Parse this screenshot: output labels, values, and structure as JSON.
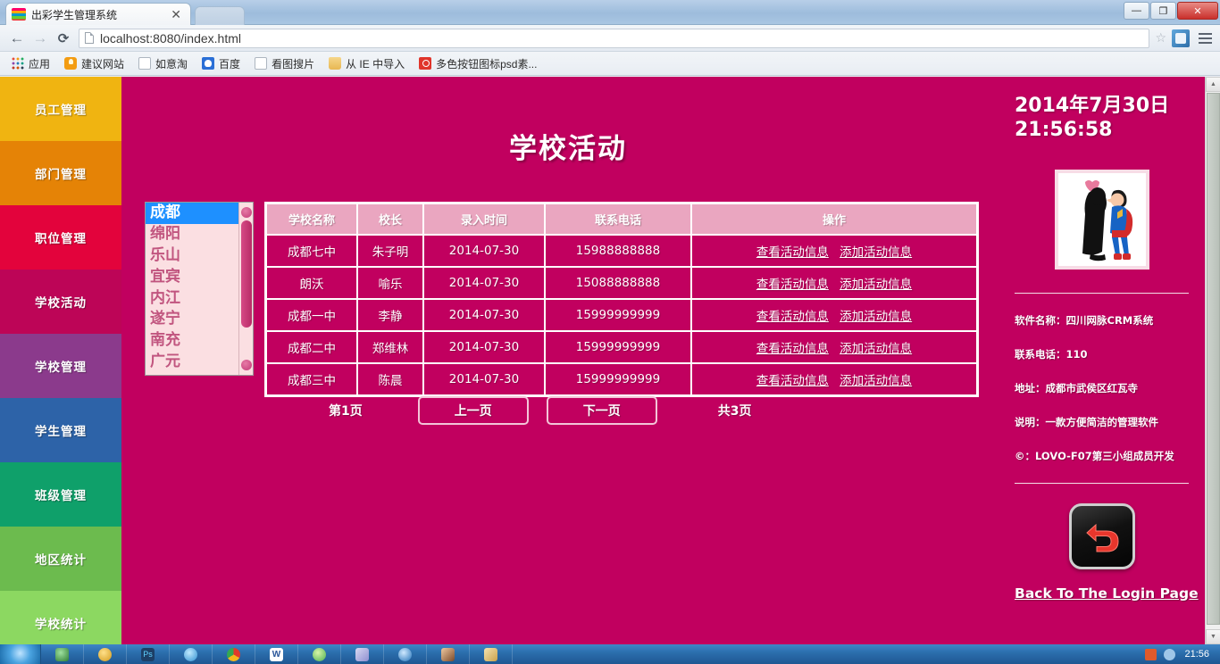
{
  "browser": {
    "tab_title": "出彩学生管理系统",
    "tab_close": "✕",
    "back_icon": "←",
    "forward_icon": "→",
    "reload_icon": "⟳",
    "url": "localhost:8080/index.html",
    "star_icon": "☆",
    "minimize": "—",
    "maximize": "❐",
    "close": "✕",
    "bookmarks": [
      {
        "label": "应用",
        "icon": "apps-grid-icon"
      },
      {
        "label": "建议网站",
        "icon": "lightbulb-icon"
      },
      {
        "label": "如意淘",
        "icon": "page-icon"
      },
      {
        "label": "百度",
        "icon": "baidu-icon"
      },
      {
        "label": "看图搜片",
        "icon": "page-icon"
      },
      {
        "label": "从 IE 中导入",
        "icon": "folder-icon"
      },
      {
        "label": "多色按钮图标psd素...",
        "icon": "red-circle-icon"
      }
    ]
  },
  "sidebar": {
    "items": [
      {
        "label": "员工管理",
        "color": "#f0b411"
      },
      {
        "label": "部门管理",
        "color": "#e58306"
      },
      {
        "label": "职位管理",
        "color": "#e3033c"
      },
      {
        "label": "学校活动",
        "color": "#bd0557"
      },
      {
        "label": "学校管理",
        "color": "#8b3a8c"
      },
      {
        "label": "学生管理",
        "color": "#2d63a8"
      },
      {
        "label": "班级管理",
        "color": "#0fa06a"
      },
      {
        "label": "地区统计",
        "color": "#6cbb4e"
      },
      {
        "label": "学校统计",
        "color": "#8cd861"
      }
    ]
  },
  "main": {
    "title": "学校活动",
    "city_list": {
      "selected": "成都",
      "items": [
        "成都",
        "绵阳",
        "乐山",
        "宜宾",
        "内江",
        "遂宁",
        "南充",
        "广元"
      ]
    },
    "table": {
      "headers": [
        "学校名称",
        "校长",
        "录入时间",
        "联系电话",
        "操作"
      ],
      "action_labels": [
        "查看活动信息",
        "添加活动信息"
      ],
      "rows": [
        {
          "name": "成都七中",
          "head": "朱子明",
          "date": "2014-07-30",
          "phone": "15988888888"
        },
        {
          "name": "朗沃",
          "head": "喻乐",
          "date": "2014-07-30",
          "phone": "15088888888"
        },
        {
          "name": "成都一中",
          "head": "李静",
          "date": "2014-07-30",
          "phone": "15999999999"
        },
        {
          "name": "成都二中",
          "head": "郑维林",
          "date": "2014-07-30",
          "phone": "15999999999"
        },
        {
          "name": "成都三中",
          "head": "陈晨",
          "date": "2014-07-30",
          "phone": "15999999999"
        }
      ]
    },
    "pager": {
      "current": "第1页",
      "prev": "上一页",
      "next": "下一页",
      "total": "共3页"
    }
  },
  "right_panel": {
    "date": "2014年7月30日",
    "time": "21:56:58",
    "photo_alt": "卡通情侣图片",
    "info": [
      "软件名称：四川网脉CRM系统",
      "联系电话：110",
      "地址：成都市武侯区红瓦寺",
      "说明：一款方便简洁的管理软件",
      "©：LOVO-F07第三小组成员开发"
    ],
    "back_link": "Back To The Login Page",
    "back_icon_name": "undo-arrow-icon"
  },
  "taskbar": {
    "clock": "21:56"
  },
  "colors": {
    "page_bg": "#c1005f",
    "table_header": "#eaa6c0",
    "selected_city": "#1e90ff",
    "city_bg": "#fbdfe2"
  }
}
